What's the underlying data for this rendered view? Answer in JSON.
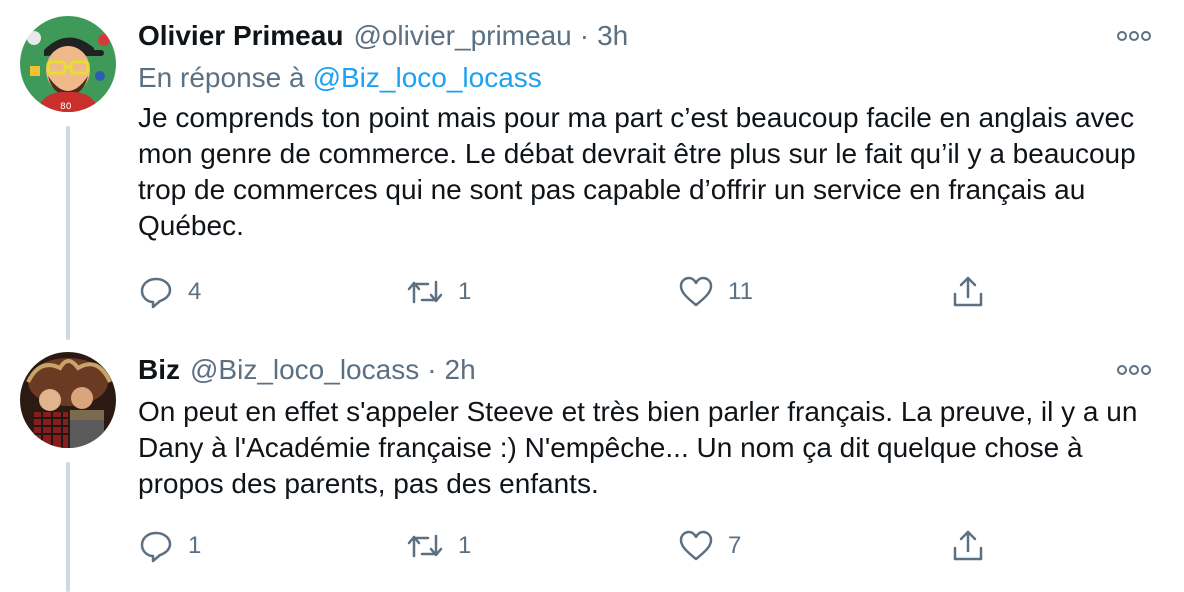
{
  "tweets": [
    {
      "name": "Olivier Primeau",
      "handle": "@olivier_primeau",
      "separator": "·",
      "time": "3h",
      "reply_prefix": "En réponse à",
      "reply_mention": "@Biz_loco_locass",
      "text": "Je comprends ton point mais pour ma part c’est beaucoup facile en anglais avec mon genre de commerce. Le débat devrait être plus sur le fait qu’il y a beaucoup trop de commerces qui ne sont pas capable d’offrir un service en français au Québec.",
      "replies": "4",
      "retweets": "1",
      "likes": "11",
      "avatar_icon": "cartoon-avatar-icon"
    },
    {
      "name": "Biz",
      "handle": "@Biz_loco_locass",
      "separator": "·",
      "time": "2h",
      "text": "On peut en effet s'appeler Steeve et très bien parler français. La preuve, il y a un Dany à l'Académie française :) N'empêche... Un nom ça dit quelque chose à propos des parents, pas des enfants.",
      "replies": "1",
      "retweets": "1",
      "likes": "7",
      "avatar_icon": "photo-avatar-icon"
    }
  ],
  "icons": {
    "more": "more-options-icon",
    "reply": "reply-icon",
    "retweet": "retweet-icon",
    "like": "heart-icon",
    "share": "share-icon"
  },
  "colors": {
    "text": "#0f1419",
    "secondary": "#5b7083",
    "link": "#1da1f2",
    "thread_line": "#cfd9de"
  }
}
